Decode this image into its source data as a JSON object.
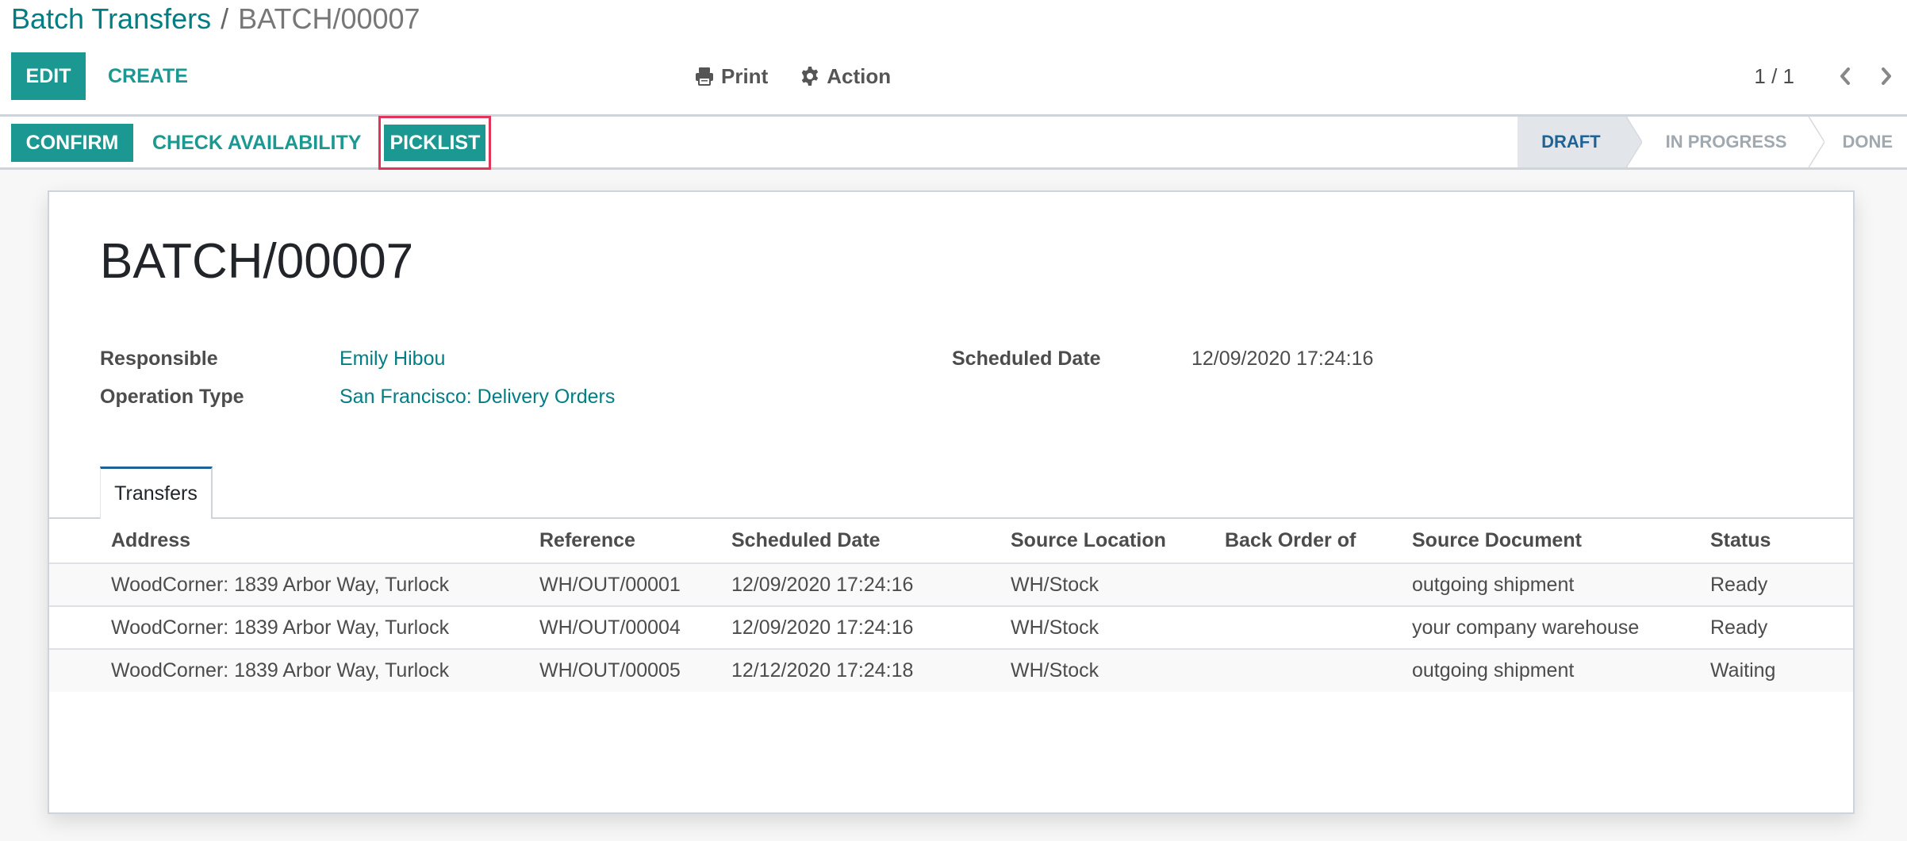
{
  "breadcrumb": {
    "parent": "Batch Transfers",
    "separator": "/",
    "current": "BATCH/00007"
  },
  "toolbar": {
    "edit_label": "EDIT",
    "create_label": "CREATE",
    "print_label": "Print",
    "print_icon": "printer-icon",
    "action_label": "Action",
    "action_icon": "gear-icon"
  },
  "pager": {
    "value": "1 / 1",
    "prev_icon": "chevron-left-icon",
    "next_icon": "chevron-right-icon"
  },
  "statusbar": {
    "buttons": {
      "confirm": "CONFIRM",
      "check_availability": "CHECK AVAILABILITY",
      "picklist": "PICKLIST"
    },
    "highlight_color": "#e0355b",
    "stages": [
      {
        "label": "DRAFT",
        "active": true
      },
      {
        "label": "IN PROGRESS",
        "active": false
      },
      {
        "label": "DONE",
        "active": false
      }
    ]
  },
  "record": {
    "title": "BATCH/00007",
    "fields": {
      "responsible_label": "Responsible",
      "responsible_value": "Emily Hibou",
      "operation_type_label": "Operation Type",
      "operation_type_value": "San Francisco: Delivery Orders",
      "scheduled_date_label": "Scheduled Date",
      "scheduled_date_value": "12/09/2020 17:24:16"
    }
  },
  "tabs": [
    {
      "label": "Transfers",
      "active": true
    }
  ],
  "transfers": {
    "columns": [
      "Address",
      "Reference",
      "Scheduled Date",
      "Source Location",
      "Back Order of",
      "Source Document",
      "Status"
    ],
    "rows": [
      [
        "WoodCorner: 1839 Arbor Way, Turlock",
        "WH/OUT/00001",
        "12/09/2020 17:24:16",
        "WH/Stock",
        "",
        "outgoing shipment",
        "Ready"
      ],
      [
        "WoodCorner: 1839 Arbor Way, Turlock",
        "WH/OUT/00004",
        "12/09/2020 17:24:16",
        "WH/Stock",
        "",
        "your company warehouse",
        "Ready"
      ],
      [
        "WoodCorner: 1839 Arbor Way, Turlock",
        "WH/OUT/00005",
        "12/12/2020 17:24:18",
        "WH/Stock",
        "",
        "outgoing shipment",
        "Waiting"
      ]
    ]
  },
  "colors": {
    "primary": "#1a9891",
    "link": "#017e84",
    "active_stage_text": "#1f6396",
    "background": "#f7f7f7"
  }
}
